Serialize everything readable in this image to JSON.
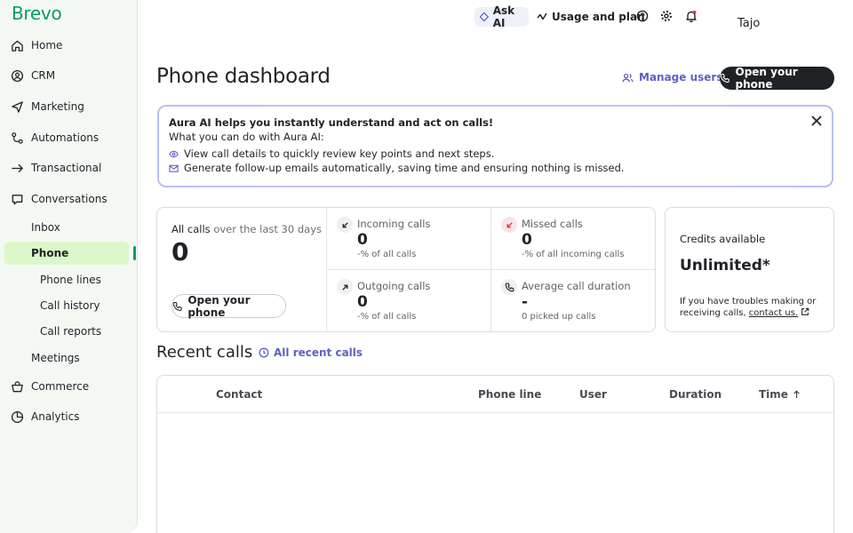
{
  "brand": {
    "logo": "Brevo",
    "accent": "#0b996e"
  },
  "sidebar": {
    "items": [
      {
        "label": "Home",
        "icon": "home-icon"
      },
      {
        "label": "CRM",
        "icon": "contacts-icon"
      },
      {
        "label": "Marketing",
        "icon": "send-icon"
      },
      {
        "label": "Automations",
        "icon": "automation-icon"
      },
      {
        "label": "Transactional",
        "icon": "transactional-icon"
      },
      {
        "label": "Conversations",
        "icon": "chat-icon"
      }
    ],
    "conversations_sub": {
      "inbox": "Inbox",
      "phone": "Phone",
      "phone_lines": "Phone lines",
      "call_history": "Call history",
      "call_reports": "Call reports",
      "meetings": "Meetings"
    },
    "bottom_items": [
      {
        "label": "Commerce",
        "icon": "cart-icon"
      },
      {
        "label": "Analytics",
        "icon": "analytics-icon"
      }
    ]
  },
  "topbar": {
    "ask_ai": "Ask AI",
    "usage": "Usage and plan",
    "user": "Tajo"
  },
  "header": {
    "title": "Phone dashboard",
    "manage_users": "Manage users",
    "open_phone": "Open your phone"
  },
  "banner": {
    "title": "Aura AI helps you instantly understand and act on calls!",
    "subtitle": "What you can do with Aura AI:",
    "point1": "View call details to quickly review key points and next steps.",
    "point2": "Generate follow-up emails automatically, saving time and ensuring nothing is missed."
  },
  "stats": {
    "all_calls_label": "All calls",
    "all_calls_period": "over the last 30 days",
    "all_calls_value": "0",
    "open_phone": "Open your phone",
    "incoming": {
      "label": "Incoming calls",
      "value": "0",
      "sub": "-% of all calls"
    },
    "missed": {
      "label": "Missed calls",
      "value": "0",
      "sub": "-% of all incoming calls"
    },
    "outgoing": {
      "label": "Outgoing calls",
      "value": "0",
      "sub": "-% of all calls"
    },
    "average": {
      "label": "Average call duration",
      "value": "-",
      "sub": "0 picked up calls"
    }
  },
  "credits": {
    "label": "Credits available",
    "value": "Unlimited*",
    "note": "If you have troubles making or receiving calls,",
    "link": "contact us."
  },
  "recent": {
    "title": "Recent calls",
    "link": "All recent calls",
    "columns": [
      "Contact",
      "Phone line",
      "User",
      "Duration",
      "Time"
    ]
  },
  "colors": {
    "accent_purple": "#5e61c6",
    "active_bg": "#dcf7c9",
    "missed_red": "#d6334a",
    "dark": "#1f2328"
  }
}
